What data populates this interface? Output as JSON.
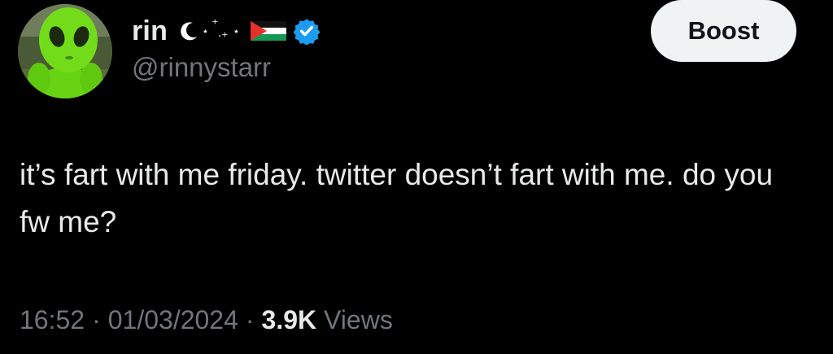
{
  "author": {
    "display_name": "rin",
    "handle": "@rinnystarr",
    "avatar_icon": "green-alien-plush-avatar",
    "name_decorations": [
      "crescent-moon-icon",
      "sparkle-stars-icon",
      "palestine-flag-icon"
    ],
    "verified": true
  },
  "actions": {
    "boost_label": "Boost"
  },
  "tweet": {
    "text": "it’s fart with me friday. twitter doesn’t fart with me. do you fw me?"
  },
  "meta": {
    "time": "16:52",
    "separator": "·",
    "date": "01/03/2024",
    "views_count": "3.9K",
    "views_label": "Views"
  },
  "colors": {
    "background": "#000000",
    "text_primary": "#e7e9ea",
    "text_secondary": "#71767b",
    "button_bg": "#eff3f4",
    "button_text": "#0f1419",
    "verified_badge": "#1d9bf0"
  }
}
